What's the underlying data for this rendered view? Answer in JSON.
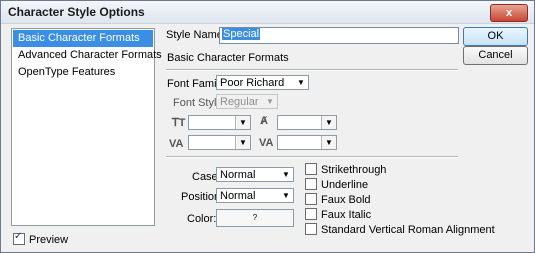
{
  "window": {
    "title": "Character Style Options",
    "close_label": "x"
  },
  "sidebar": {
    "items": [
      {
        "label": "Basic Character Formats"
      },
      {
        "label": "Advanced Character Formats"
      },
      {
        "label": "OpenType Features"
      }
    ]
  },
  "preview": {
    "label": "Preview",
    "checked": true
  },
  "style_name": {
    "label": "Style Name:",
    "value": "Special"
  },
  "section_title": "Basic Character Formats",
  "font_family": {
    "label": "Font Family:",
    "value": "Poor Richard"
  },
  "font_style": {
    "label": "Font Style:",
    "value": "Regular"
  },
  "metrics": {
    "size_icon": "font-size-icon",
    "leading_icon": "leading-icon",
    "kerning_icon": "kerning-icon",
    "tracking_icon": "tracking-icon"
  },
  "case": {
    "label": "Case:",
    "value": "Normal"
  },
  "position": {
    "label": "Position:",
    "value": "Normal"
  },
  "color": {
    "label": "Color:",
    "value": "?"
  },
  "options": [
    {
      "label": "Strikethrough",
      "checked": false
    },
    {
      "label": "Underline",
      "checked": false
    },
    {
      "label": "Faux Bold",
      "checked": false
    },
    {
      "label": "Faux Italic",
      "checked": false
    },
    {
      "label": "Standard Vertical Roman Alignment",
      "checked": false
    }
  ],
  "buttons": {
    "ok": "OK",
    "cancel": "Cancel"
  }
}
